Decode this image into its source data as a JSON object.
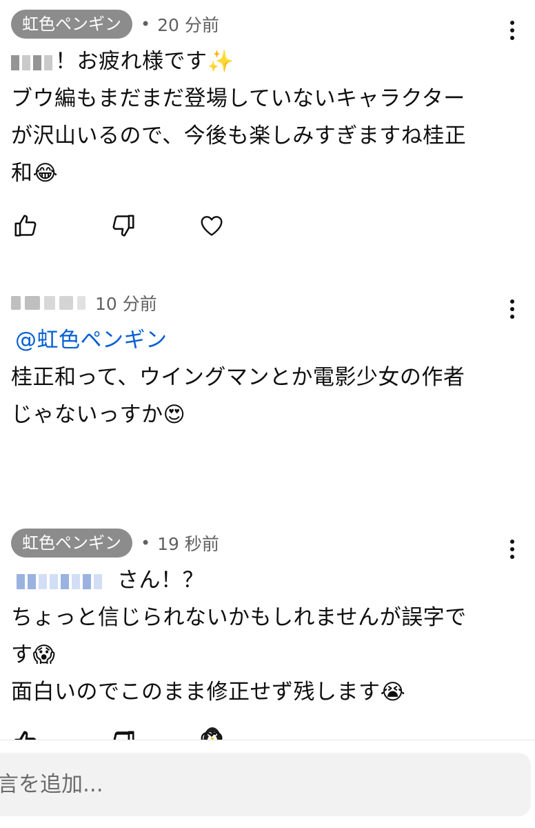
{
  "comments": [
    {
      "author": "虹色ペンギン",
      "author_is_owner": true,
      "time": "20 分前",
      "lines": [
        "！お疲れ様です✨",
        "ブウ編もまだまだ登場していないキャラクター",
        "が沢山いるので、今後も楽しみすぎますね桂正",
        "和😂"
      ]
    },
    {
      "author": "",
      "time": "10 分前",
      "mention": "@虹色ペンギン",
      "lines": [
        "桂正和って、ウイングマンとか電影少女の作者",
        "じゃないっすか😍"
      ],
      "creator_heart": true
    },
    {
      "author": "虹色ペンギン",
      "author_is_owner": true,
      "time": "19 秒前",
      "mention_suffix": "さん！？",
      "lines": [
        "ちょっと信じられないかもしれませんが誤字で",
        "す😱",
        "面白いのでこのまま修正せず残します😭"
      ]
    }
  ],
  "reply_input": {
    "placeholder": "言を追加..."
  },
  "icons": {
    "like": "thumbs-up-icon",
    "dislike": "thumbs-down-icon",
    "heart": "heart-icon",
    "more": "more-vertical-icon",
    "creator_heart": "penguin-heart-icon"
  },
  "colors": {
    "owner_chip": "#8c8c8c",
    "mention": "#065fd4",
    "meta_text": "#606060",
    "heart_red": "#ee1c25"
  }
}
